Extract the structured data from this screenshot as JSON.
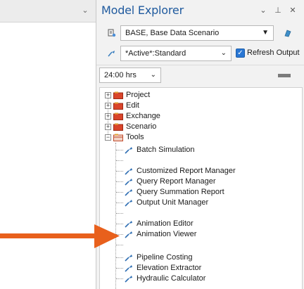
{
  "panel": {
    "title": "Model Explorer",
    "title_buttons": [
      "⌄",
      "⊥",
      "✕"
    ]
  },
  "scenario": {
    "icon": "scenario-icon",
    "value": "BASE, Base Data Scenario"
  },
  "profile": {
    "icon": "profile-icon",
    "value": "*Active*:Standard",
    "refresh_output": {
      "label": "Refresh Output",
      "checked": true
    }
  },
  "time": {
    "value": "24:00 hrs"
  },
  "tree": {
    "folders": [
      {
        "label": "Project",
        "expanded": false
      },
      {
        "label": "Edit",
        "expanded": false
      },
      {
        "label": "Exchange",
        "expanded": false
      },
      {
        "label": "Scenario",
        "expanded": false
      },
      {
        "label": "Tools",
        "expanded": true
      }
    ],
    "tools": [
      "Batch Simulation",
      "Customized Report Manager",
      "Query Report Manager",
      "Query Summation Report",
      "Output Unit Manager",
      "Animation Editor",
      "Animation Viewer",
      "Pipeline Costing",
      "Elevation Extractor",
      "Hydraulic Calculator"
    ]
  },
  "colors": {
    "title": "#1f5a9e",
    "accent_arrow": "#e8601c",
    "checkbox": "#2a77d4"
  }
}
